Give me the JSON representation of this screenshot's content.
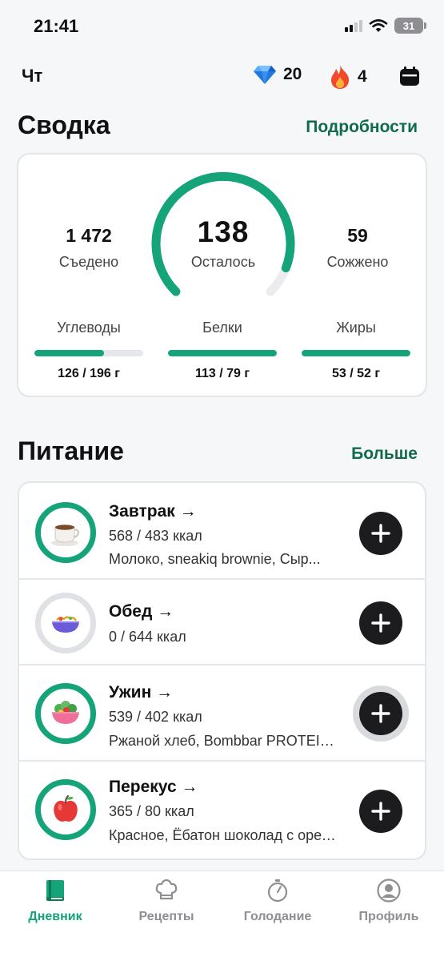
{
  "status": {
    "time": "21:41",
    "battery": "31"
  },
  "header": {
    "day": "Чт",
    "gems": "20",
    "streak": "4",
    "icons": [
      "diamond-icon",
      "flame-icon",
      "calendar-icon"
    ]
  },
  "summary": {
    "title": "Сводка",
    "link": "Подробности",
    "eaten": {
      "value": "1 472",
      "label": "Съедено"
    },
    "remaining": {
      "value": "138",
      "label": "Осталось"
    },
    "burned": {
      "value": "59",
      "label": "Сожжено"
    },
    "gauge_progress": 0.91,
    "macros": [
      {
        "name": "Углеводы",
        "value": "126 / 196 г",
        "progress": 0.64
      },
      {
        "name": "Белки",
        "value": "113 / 79 г",
        "progress": 1.0
      },
      {
        "name": "Жиры",
        "value": "53 / 52 г",
        "progress": 1.0
      }
    ]
  },
  "nutrition": {
    "title": "Питание",
    "link": "Больше",
    "meals": [
      {
        "title": "Завтрак →",
        "kcal": "568 / 483 ккал",
        "items": "Молоко, sneakiq brownie, Сыр...",
        "icon": "coffee-icon"
      },
      {
        "title": "Обед →",
        "kcal": "0 / 644 ккал",
        "items": "",
        "icon": "noodles-icon"
      },
      {
        "title": "Ужин →",
        "kcal": "539 / 402 ккал",
        "items": "Ржаной хлеб, Bombbar PROTEIN...",
        "icon": "salad-icon"
      },
      {
        "title": "Перекус →",
        "kcal": "365 / 80 ккал",
        "items": "Красное, Ёбатон шоколад с орехами",
        "icon": "apple-icon"
      }
    ]
  },
  "tabs": [
    {
      "label": "Дневник",
      "icon": "book-icon",
      "active": true
    },
    {
      "label": "Рецепты",
      "icon": "chef-hat-icon",
      "active": false
    },
    {
      "label": "Голодание",
      "icon": "stopwatch-icon",
      "active": false
    },
    {
      "label": "Профиль",
      "icon": "profile-icon",
      "active": false
    }
  ],
  "colors": {
    "accent": "#15a37a",
    "link": "#0f6b4a",
    "button": "#1c1c1e"
  }
}
